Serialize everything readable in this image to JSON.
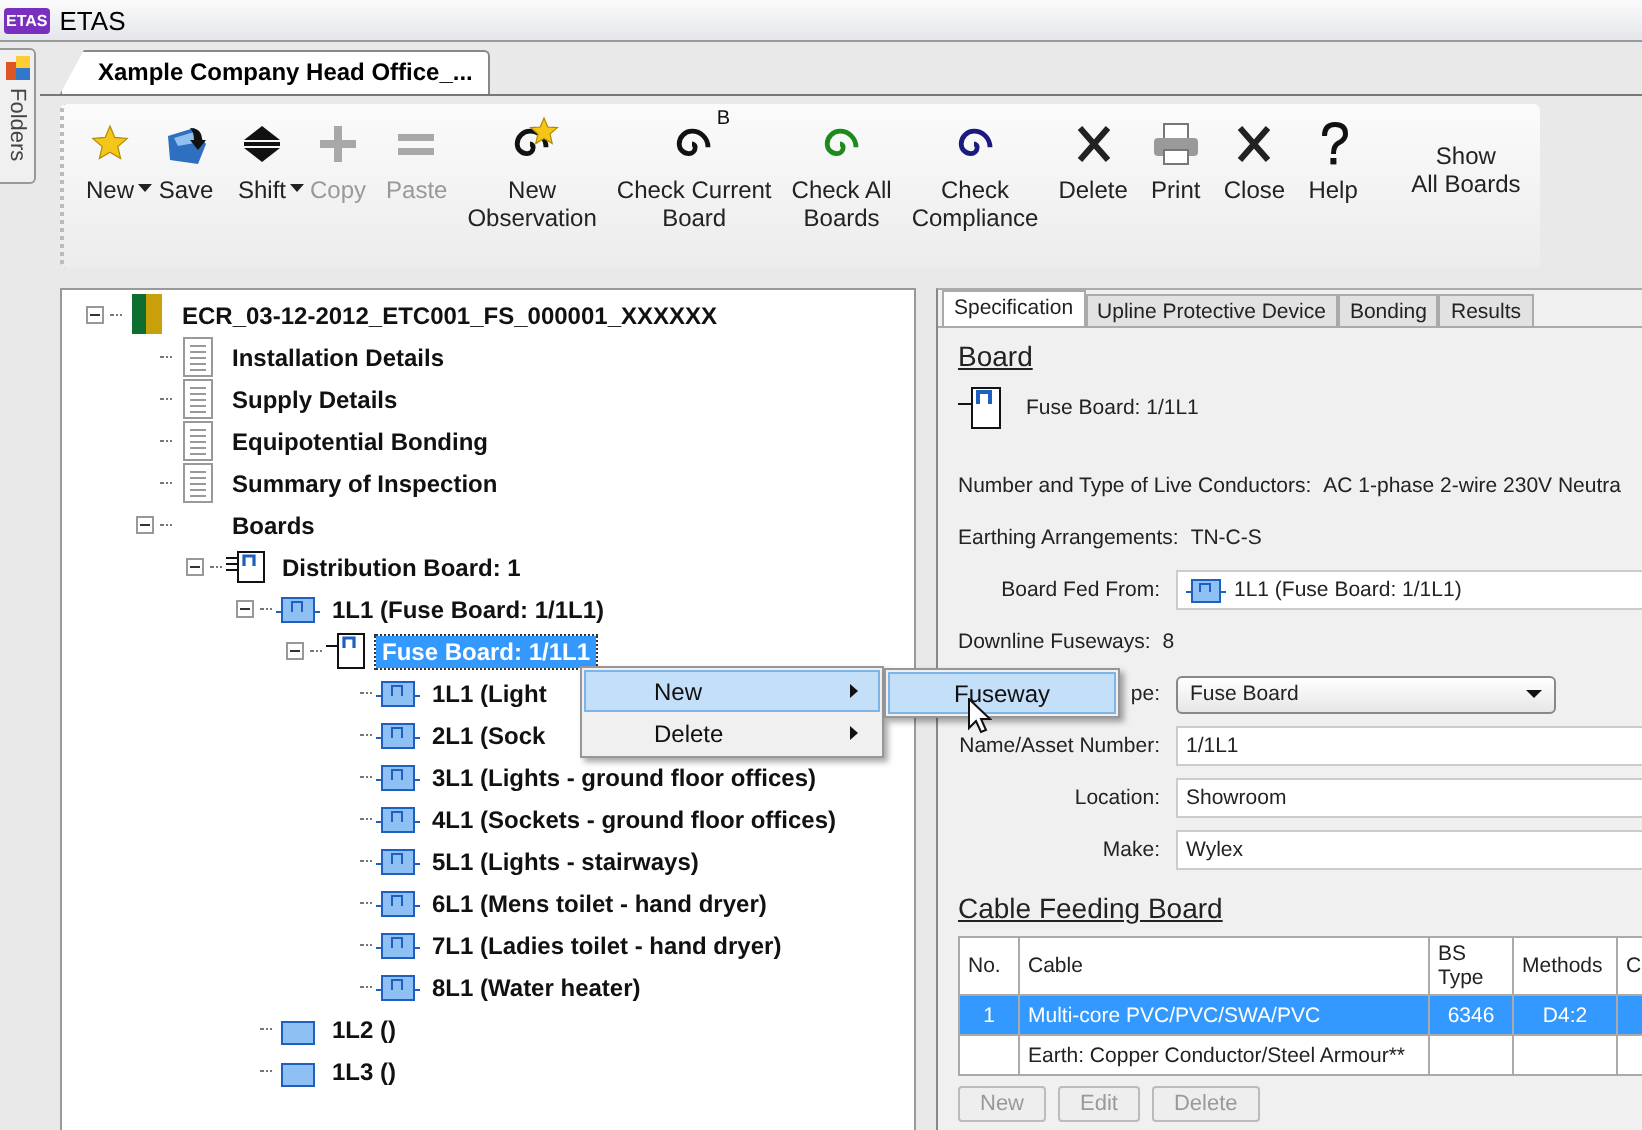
{
  "title_bar": {
    "logo_text": "ETAS",
    "title": "ETAS"
  },
  "folders_panel": {
    "label": "Folders"
  },
  "document_tab": {
    "title": "Xample Company Head Office_...",
    "selected": true
  },
  "toolbar": {
    "buttons": [
      {
        "label": "New",
        "kind": "star",
        "disabled": false,
        "dropdown": true
      },
      {
        "label": "Save",
        "kind": "save",
        "disabled": false,
        "dropdown": false
      },
      {
        "label": "Shift",
        "kind": "shift",
        "disabled": false,
        "dropdown": true
      },
      {
        "label": "Copy",
        "kind": "plus",
        "disabled": true,
        "dropdown": false
      },
      {
        "label": "Paste",
        "kind": "equals",
        "disabled": true,
        "dropdown": false
      },
      {
        "label": "New\nObservation",
        "kind": "spiral-star",
        "disabled": false,
        "dropdown": false
      },
      {
        "label": "Check Current\nBoard",
        "kind": "spiral-black",
        "badge": "B",
        "disabled": false,
        "dropdown": false
      },
      {
        "label": "Check All\nBoards",
        "kind": "spiral-green",
        "disabled": false,
        "dropdown": false
      },
      {
        "label": "Check\nCompliance",
        "kind": "spiral-navy",
        "disabled": false,
        "dropdown": false
      },
      {
        "label": "Delete",
        "kind": "cross",
        "disabled": false,
        "dropdown": false
      },
      {
        "label": "Print",
        "kind": "printer",
        "disabled": false,
        "dropdown": false
      },
      {
        "label": "Close",
        "kind": "cross",
        "disabled": false,
        "dropdown": false
      },
      {
        "label": "Help",
        "kind": "help",
        "disabled": false,
        "dropdown": false
      }
    ],
    "side_button": {
      "label": "Show\nAll Boards"
    }
  },
  "tree": {
    "nodes": [
      {
        "label": "ECR_03-12-2012_ETC001_FS_000001_XXXXXX",
        "kind": "report",
        "expanded": true,
        "selected": false,
        "children": [
          {
            "label": "Installation Details",
            "kind": "document",
            "selected": false
          },
          {
            "label": "Supply Details",
            "kind": "document",
            "selected": false
          },
          {
            "label": "Equipotential Bonding",
            "kind": "document",
            "selected": false
          },
          {
            "label": "Summary of Inspection",
            "kind": "document",
            "selected": false
          },
          {
            "label": "Boards",
            "kind": "group",
            "expanded": true,
            "selected": false,
            "children": [
              {
                "label": "Distribution Board: 1",
                "kind": "distribution-board",
                "expanded": true,
                "selected": false,
                "children": [
                  {
                    "label": "1L1 (Fuse Board: 1/1L1)",
                    "kind": "fuseway",
                    "expanded": true,
                    "selected": false,
                    "children": [
                      {
                        "label": "Fuse Board: 1/1L1",
                        "kind": "board",
                        "expanded": true,
                        "selected": true,
                        "children": [
                          {
                            "label": "1L1 (Light",
                            "kind": "fuseway",
                            "selected": false
                          },
                          {
                            "label": "2L1 (Sock",
                            "kind": "fuseway",
                            "selected": false
                          },
                          {
                            "label": "3L1 (Lights - ground floor offices)",
                            "kind": "fuseway",
                            "selected": false
                          },
                          {
                            "label": "4L1 (Sockets - ground floor offices)",
                            "kind": "fuseway",
                            "selected": false
                          },
                          {
                            "label": "5L1 (Lights - stairways)",
                            "kind": "fuseway",
                            "selected": false
                          },
                          {
                            "label": "6L1 (Mens toilet - hand dryer)",
                            "kind": "fuseway",
                            "selected": false
                          },
                          {
                            "label": "7L1 (Ladies toilet - hand dryer)",
                            "kind": "fuseway",
                            "selected": false
                          },
                          {
                            "label": "8L1 (Water heater)",
                            "kind": "fuseway",
                            "selected": false
                          }
                        ]
                      }
                    ]
                  },
                  {
                    "label": "1L2 ()",
                    "kind": "spare",
                    "selected": false
                  },
                  {
                    "label": "1L3 ()",
                    "kind": "spare",
                    "selected": false
                  }
                ]
              }
            ]
          }
        ]
      }
    ]
  },
  "context_menu": {
    "items": [
      {
        "label": "New",
        "selected": true,
        "has_submenu": true
      },
      {
        "label": "Delete",
        "selected": false,
        "has_submenu": true
      }
    ],
    "submenu": {
      "items": [
        {
          "label": "Fuseway",
          "selected": true
        }
      ]
    }
  },
  "details": {
    "tabs": [
      {
        "label": "Specification",
        "selected": true
      },
      {
        "label": "Upline Protective Device",
        "selected": false
      },
      {
        "label": "Bonding",
        "selected": false
      },
      {
        "label": "Results",
        "selected": false
      }
    ],
    "board_heading": "Board",
    "board_label": "Fuse Board: 1/1L1",
    "fields": [
      {
        "kind": "text",
        "label": "Number and Type of Live Conductors:",
        "value": "AC 1-phase 2-wire 230V Neutra"
      },
      {
        "kind": "text",
        "label": "Earthing Arrangements:",
        "value": "TN-C-S"
      },
      {
        "kind": "combo",
        "label": "Board Fed From:",
        "value": "1L1 (Fuse Board: 1/1L1)"
      },
      {
        "kind": "text",
        "label": "Downline Fuseways:",
        "value": "8"
      },
      {
        "kind": "select",
        "label": "pe:",
        "value": "Fuse Board"
      },
      {
        "kind": "input",
        "label": "Name/Asset Number:",
        "value": "1/1L1"
      },
      {
        "kind": "input",
        "label": "Location:",
        "value": "Showroom"
      },
      {
        "kind": "input",
        "label": "Make:",
        "value": "Wylex"
      }
    ],
    "cable_heading": "Cable Feeding Board",
    "cable_table": {
      "columns": [
        "No.",
        "Cable",
        "BS Type",
        "Methods",
        "C"
      ],
      "rows": [
        {
          "no": "1",
          "cable": "Multi-core PVC/PVC/SWA/PVC",
          "bs_type": "6346",
          "methods": "D4:2",
          "selected": true
        },
        {
          "cable": "Earth: Copper Conductor/Steel Armour**",
          "selected": false
        }
      ]
    },
    "buttons": [
      {
        "label": "New",
        "disabled": true
      },
      {
        "label": "Edit",
        "disabled": true
      },
      {
        "label": "Delete",
        "disabled": true
      }
    ]
  }
}
